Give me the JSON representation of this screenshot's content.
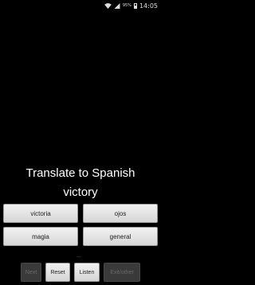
{
  "statusbar": {
    "battery_pct": "95%",
    "time": "14:05"
  },
  "quiz": {
    "instruction": "Translate to Spanish",
    "word": "victory",
    "answers": [
      "victoria",
      "ojos",
      "magia",
      "general"
    ],
    "page_indicator": "..."
  },
  "controls": {
    "next": "Next",
    "reset": "Reset",
    "listen": "Listen",
    "exit": "Exit/other"
  }
}
